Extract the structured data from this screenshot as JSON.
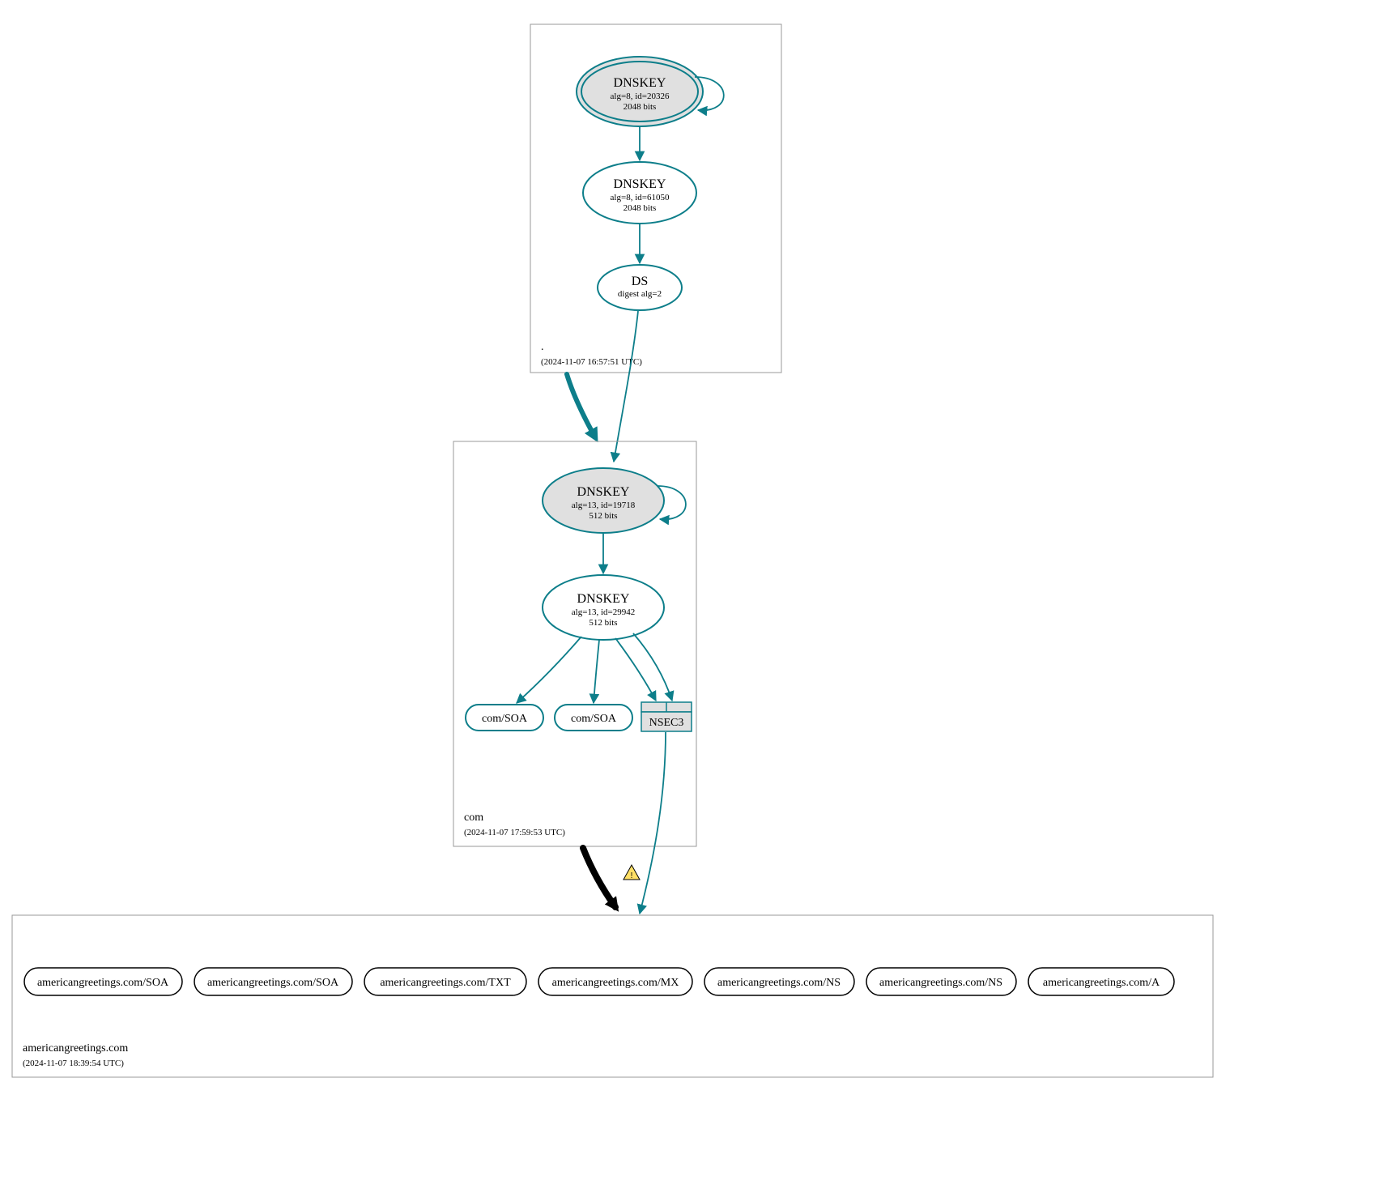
{
  "colors": {
    "teal": "#0d7e8a",
    "ksk_fill": "#e0e0e0"
  },
  "zones": {
    "root": {
      "name": ".",
      "timestamp": "(2024-11-07 16:57:51 UTC)",
      "nodes": {
        "ksk": {
          "title": "DNSKEY",
          "sub1": "alg=8, id=20326",
          "sub2": "2048 bits"
        },
        "zsk": {
          "title": "DNSKEY",
          "sub1": "alg=8, id=61050",
          "sub2": "2048 bits"
        },
        "ds": {
          "title": "DS",
          "sub1": "digest alg=2"
        }
      }
    },
    "com": {
      "name": "com",
      "timestamp": "(2024-11-07 17:59:53 UTC)",
      "nodes": {
        "ksk": {
          "title": "DNSKEY",
          "sub1": "alg=13, id=19718",
          "sub2": "512 bits"
        },
        "zsk": {
          "title": "DNSKEY",
          "sub1": "alg=13, id=29942",
          "sub2": "512 bits"
        },
        "soa1": {
          "label": "com/SOA"
        },
        "soa2": {
          "label": "com/SOA"
        },
        "nsec3": {
          "label": "NSEC3"
        }
      }
    },
    "ag": {
      "name": "americangreetings.com",
      "timestamp": "(2024-11-07 18:39:54 UTC)",
      "records": [
        "americangreetings.com/SOA",
        "americangreetings.com/SOA",
        "americangreetings.com/TXT",
        "americangreetings.com/MX",
        "americangreetings.com/NS",
        "americangreetings.com/NS",
        "americangreetings.com/A"
      ]
    }
  }
}
